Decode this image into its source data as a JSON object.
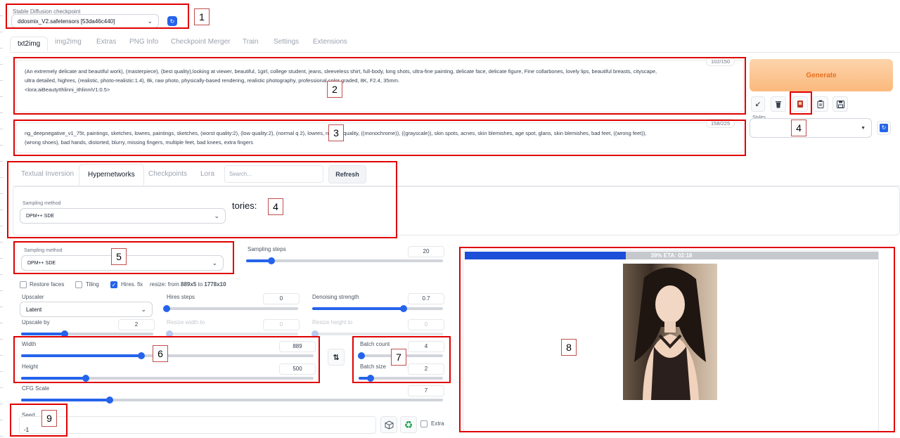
{
  "checkpoint": {
    "label": "Stable Diffusion checkpoint",
    "value": "ddosmix_V2.safetensors [53da46c440]",
    "refresh_icon": "refresh-icon"
  },
  "tabs": [
    "txt2img",
    "img2img",
    "Extras",
    "PNG Info",
    "Checkpoint Merger",
    "Train",
    "Settings",
    "Extensions"
  ],
  "prompt": {
    "counter": "102/150",
    "text_line1": "(An extremely delicate and beautiful work), (masterpiece), (best quality),looking at viewer, beautiful, 1girl, college student, jeans, sleeveless shirt, full-body, long shots, ultra-fine painting, delicate face, delicate figure, Fine collarbones, lovely lips, beautiful breasts, cityscape,",
    "text_line2": "ultra detailed, highres, (realistic, photo-realistic:1.4), 8k, raw photo,  physically-based rendering,  realistic photography, professional color graded, 8K, F2.4, 35mm.",
    "text_line3": "<lora:aiBeautyIthlinni_ithlinniV1:0.5>"
  },
  "negative_prompt": {
    "counter": "158/225",
    "text_line1": "ng_deepnegative_v1_75t, paintings, sketches, lowres, paintings, sketches, (worst quality:2), (low quality:2), (normal q  2), lowres, normal quality, ((monochrome)), ((grayscale)), skin spots, acnes, skin blemishes, age spot, glans, skin blemishes, bad feet, ((wrong feet)),",
    "text_line2": "(wrong shoes), bad hands, distorted, blurry, missing fingers, multiple feet, bad knees, extra fingers"
  },
  "generate": {
    "label": "Generate",
    "tool_icons": [
      "arrow-icon",
      "trash-icon",
      "red-card-icon",
      "clipboard-icon",
      "save-icon"
    ],
    "styles_label": "Styles"
  },
  "extra_networks": {
    "tabs": [
      "Textual Inversion",
      "Hypernetworks",
      "Checkpoints",
      "Lora"
    ],
    "search_placeholder": "Search...",
    "refresh_label": "Refresh",
    "sampling_label": "Sampling method",
    "sampling_value": "DPM++ SDE",
    "overlay_text": "tories:"
  },
  "sampling": {
    "method_label": "Sampling method",
    "method_value": "DPM++ SDE",
    "steps_label": "Sampling steps",
    "steps_value": "20",
    "steps_fraction": 0.13
  },
  "options": {
    "restore_faces": "Restore faces",
    "tiling": "Tiling",
    "hires_fix": "Hires. fix",
    "resize_text_prefix": "resize: from ",
    "resize_from": "889x5",
    "resize_mid": " to ",
    "resize_to": "1778x10"
  },
  "hires": {
    "upscaler_label": "Upscaler",
    "upscaler_value": "Latent",
    "hires_steps_label": "Hires steps",
    "hires_steps_value": "0",
    "hires_steps_fraction": 0.0,
    "denoising_label": "Denoising strength",
    "denoising_value": "0.7",
    "denoising_fraction": 0.7,
    "upscale_by_label": "Upscale by",
    "upscale_by_value": "2",
    "upscale_by_fraction": 0.33,
    "resize_width_label": "Resize width to",
    "resize_width_value": "0",
    "resize_height_label": "Resize height to",
    "resize_height_value": "0"
  },
  "dimensions": {
    "width_label": "Width",
    "width_value": "889",
    "width_fraction": 0.41,
    "height_label": "Height",
    "height_value": "500",
    "height_fraction": 0.22,
    "swap_icon": "swap-icon"
  },
  "batch": {
    "count_label": "Batch count",
    "count_value": "4",
    "count_fraction": 0.03,
    "size_label": "Batch size",
    "size_value": "2",
    "size_fraction": 0.14
  },
  "cfg": {
    "label": "CFG Scale",
    "value": "7",
    "fraction": 0.21
  },
  "seed": {
    "label": "Seed",
    "value": "-1",
    "extra_label": "Extra",
    "dice_icon": "dice-icon",
    "recycle_icon": "recycle-icon"
  },
  "progress": {
    "text": "39% ETA: 02:18",
    "fraction": 0.39
  },
  "annotations": [
    "1",
    "2",
    "3",
    "4",
    "4",
    "5",
    "6",
    "7",
    "8",
    "9"
  ],
  "colors": {
    "accent": "#2563eb",
    "generate_bg": "#fcc896",
    "annotation_red": "#e00000"
  }
}
